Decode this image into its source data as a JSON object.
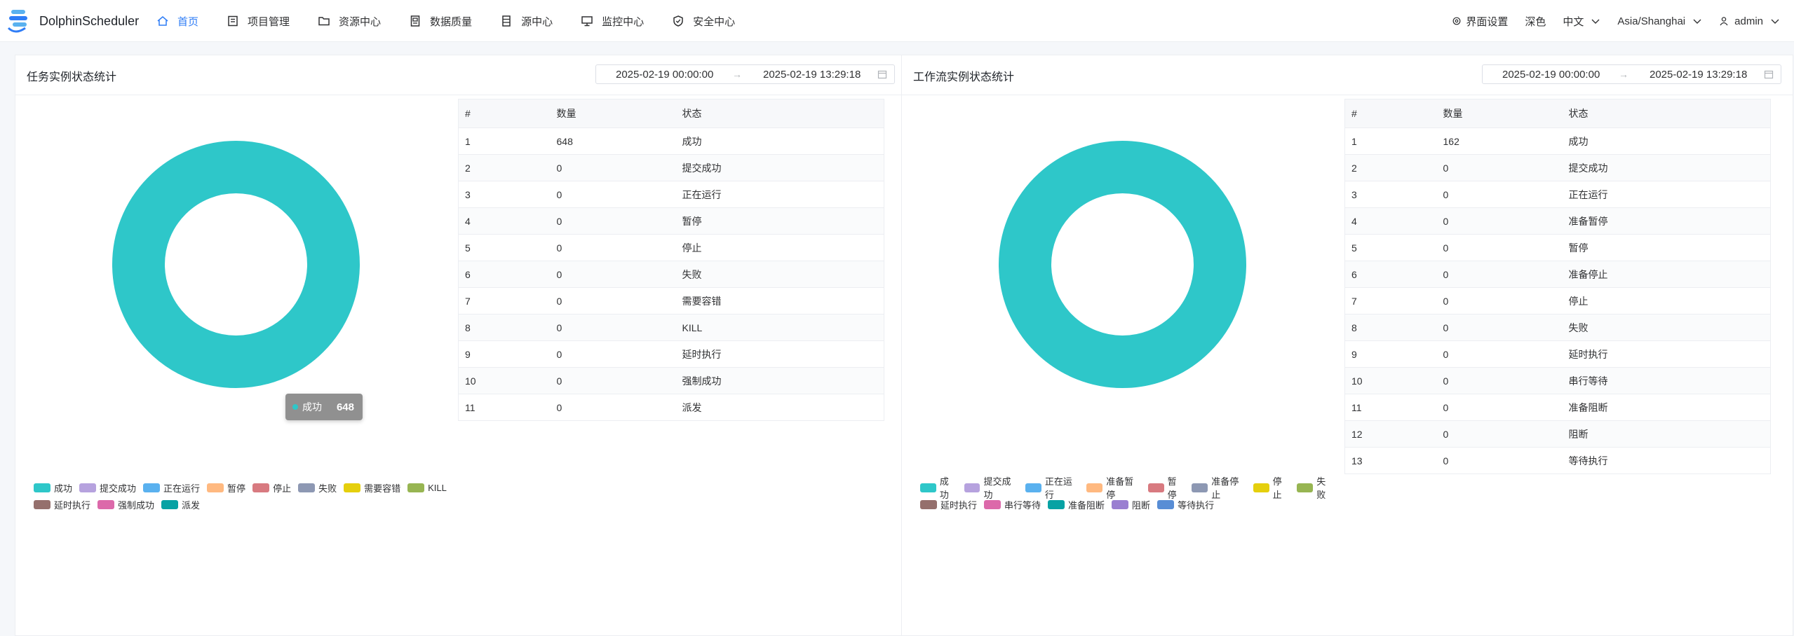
{
  "app": {
    "brand": "DolphinScheduler"
  },
  "nav": [
    {
      "label": "首页",
      "icon": "home-icon",
      "active": true
    },
    {
      "label": "项目管理",
      "icon": "project-icon",
      "active": false
    },
    {
      "label": "资源中心",
      "icon": "folder-icon",
      "active": false
    },
    {
      "label": "数据质量",
      "icon": "data-quality-icon",
      "active": false
    },
    {
      "label": "源中心",
      "icon": "datasource-icon",
      "active": false
    },
    {
      "label": "监控中心",
      "icon": "monitor-icon",
      "active": false
    },
    {
      "label": "安全中心",
      "icon": "shield-icon",
      "active": false
    }
  ],
  "tools": {
    "ui_settings": "界面设置",
    "theme": "深色",
    "language": "中文",
    "timezone": "Asia/Shanghai",
    "user": "admin"
  },
  "task_panel": {
    "title": "任务实例状态统计",
    "start": "2025-02-19 00:00:00",
    "end": "2025-02-19 13:29:18",
    "headers": [
      "#",
      "数量",
      "状态"
    ],
    "rows": [
      [
        "1",
        "648",
        "成功"
      ],
      [
        "2",
        "0",
        "提交成功"
      ],
      [
        "3",
        "0",
        "正在运行"
      ],
      [
        "4",
        "0",
        "暂停"
      ],
      [
        "5",
        "0",
        "停止"
      ],
      [
        "6",
        "0",
        "失败"
      ],
      [
        "7",
        "0",
        "需要容错"
      ],
      [
        "8",
        "0",
        "KILL"
      ],
      [
        "9",
        "0",
        "延时执行"
      ],
      [
        "10",
        "0",
        "强制成功"
      ],
      [
        "11",
        "0",
        "派发"
      ]
    ],
    "tooltip": {
      "label": "成功",
      "value": "648"
    },
    "legend": [
      [
        "成功",
        "提交成功",
        "正在运行",
        "暂停",
        "停止",
        "失败",
        "需要容错",
        "KILL"
      ],
      [
        "延时执行",
        "强制成功",
        "派发"
      ]
    ]
  },
  "workflow_panel": {
    "title": "工作流实例状态统计",
    "start": "2025-02-19 00:00:00",
    "end": "2025-02-19 13:29:18",
    "headers": [
      "#",
      "数量",
      "状态"
    ],
    "rows": [
      [
        "1",
        "162",
        "成功"
      ],
      [
        "2",
        "0",
        "提交成功"
      ],
      [
        "3",
        "0",
        "正在运行"
      ],
      [
        "4",
        "0",
        "准备暂停"
      ],
      [
        "5",
        "0",
        "暂停"
      ],
      [
        "6",
        "0",
        "准备停止"
      ],
      [
        "7",
        "0",
        "停止"
      ],
      [
        "8",
        "0",
        "失败"
      ],
      [
        "9",
        "0",
        "延时执行"
      ],
      [
        "10",
        "0",
        "串行等待"
      ],
      [
        "11",
        "0",
        "准备阻断"
      ],
      [
        "12",
        "0",
        "阻断"
      ],
      [
        "13",
        "0",
        "等待执行"
      ]
    ],
    "legend": [
      [
        "成功",
        "提交成功",
        "正在运行",
        "准备暂停",
        "暂停",
        "准备停止",
        "停止",
        "失败"
      ],
      [
        "延时执行",
        "串行等待",
        "准备阻断",
        "阻断",
        "等待执行"
      ]
    ]
  },
  "colors": {
    "accent": "#2f7df6",
    "donut": "#2ec7c9",
    "task_legend": [
      "#2ec7c9",
      "#b6a2de",
      "#5ab1ef",
      "#ffb980",
      "#d87a80",
      "#8d98b3",
      "#e5cf0d",
      "#97b552",
      "#95706d",
      "#dc69aa",
      "#07a2a4"
    ],
    "workflow_legend": [
      "#2ec7c9",
      "#b6a2de",
      "#5ab1ef",
      "#ffb980",
      "#d87a80",
      "#8d98b3",
      "#e5cf0d",
      "#97b552",
      "#95706d",
      "#dc69aa",
      "#07a2a4",
      "#9a7fd1",
      "#588dd5"
    ]
  }
}
